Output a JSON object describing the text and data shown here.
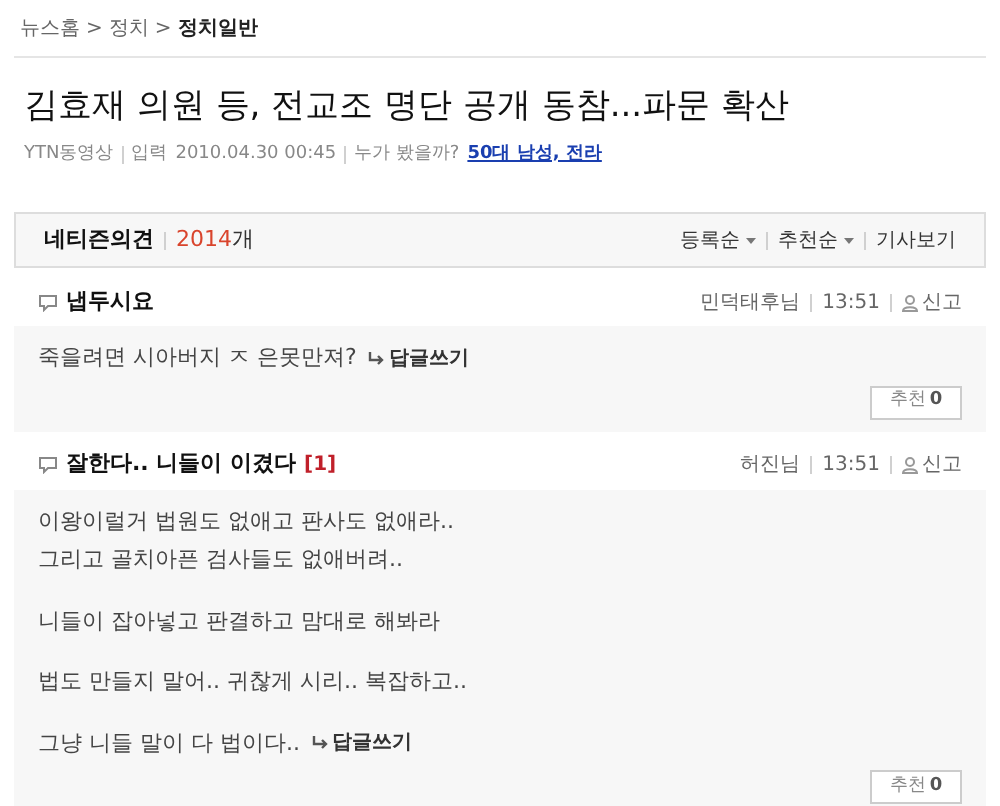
{
  "breadcrumb": [
    {
      "label": "뉴스홈",
      "current": false
    },
    {
      "label": "정치",
      "current": false
    },
    {
      "label": "정치일반",
      "current": true
    }
  ],
  "separator": ">",
  "headline": "김효재 의원 등, 전교조 명단 공개 동참...파문 확산",
  "meta": {
    "source": "YTN동영상",
    "date_label": "입력",
    "date": "2010.04.30 00:45",
    "viewers_label": "누가 봤을까?",
    "viewers_link": "50대 남성, 전라"
  },
  "comments_header": {
    "title": "네티즌의견",
    "count": "2014",
    "count_unit": "개",
    "actions": [
      {
        "label": "등록순",
        "dropdown": true
      },
      {
        "label": "추천순",
        "dropdown": true
      },
      {
        "label": "기사보기",
        "dropdown": false
      }
    ]
  },
  "comments": [
    {
      "title": "냅두시요",
      "author": "민덕태후님",
      "time": "13:51",
      "report": "신고",
      "paragraphs": [
        [
          "죽을려면 시아버지 ㅈ 은못만져?"
        ]
      ],
      "reply_link": "답글쓰기",
      "recommend_label": "추천",
      "recommend_count": "0"
    },
    {
      "title": "잘한다.. 니들이 이겼다",
      "reply_count": "[1]",
      "author": "허진님",
      "time": "13:51",
      "report": "신고",
      "paragraphs": [
        [
          "이왕이럴거 법원도 없애고 판사도 없애라..",
          "그리고 골치아픈 검사들도 없애버려.."
        ],
        [
          "니들이 잡아넣고 판결하고 맘대로 해봐라"
        ],
        [
          "법도 만들지 말어.. 귀찮게 시리.. 복잡하고.."
        ],
        [
          "그냥 니들 말이 다 법이다.."
        ]
      ],
      "reply_link": "답글쓰기",
      "recommend_label": "추천",
      "recommend_count": "0"
    }
  ]
}
